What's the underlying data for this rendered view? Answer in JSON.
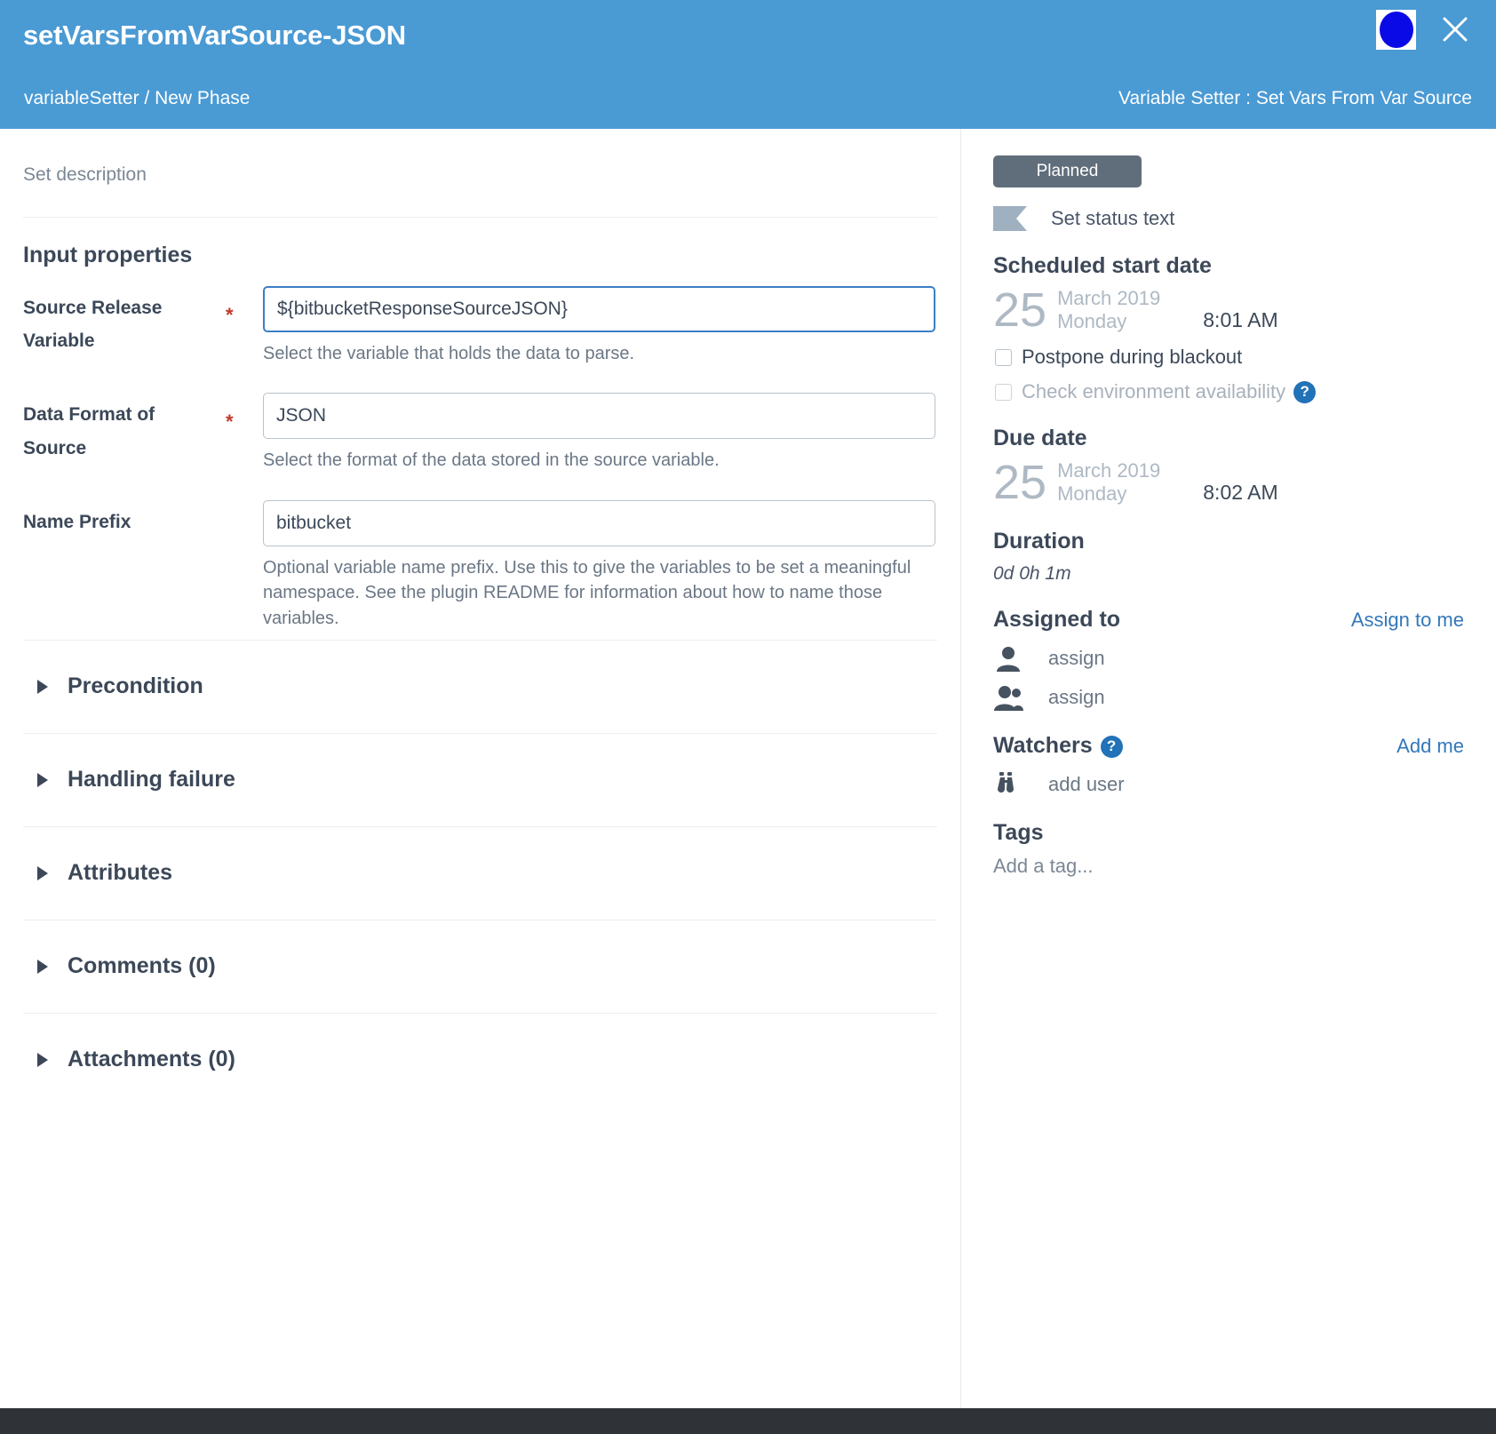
{
  "header": {
    "title": "setVarsFromVarSource-JSON",
    "breadcrumb": "variableSetter / New Phase",
    "task_type": "Variable Setter : Set Vars From Var Source",
    "avatar_icon": "user-avatar-circle-icon",
    "close_icon": "close-icon",
    "background_color": "#4a9ad4",
    "avatar_color": "#0a0ae6"
  },
  "main": {
    "set_description_placeholder": "Set description",
    "input_properties_title": "Input properties",
    "fields": [
      {
        "label": "Source Release Variable",
        "required": "*",
        "value": "${bitbucketResponseSourceJSON}",
        "help": "Select the variable that holds the data to parse.",
        "focused": true
      },
      {
        "label": "Data Format of Source",
        "required": "*",
        "value": "JSON",
        "help": "Select the format of the data stored in the source variable.",
        "focused": false
      },
      {
        "label": "Name Prefix",
        "required": "",
        "value": "bitbucket",
        "help": "Optional variable name prefix. Use this to give the variables to be set a meaningful namespace. See the plugin README for information about how to name those variables.",
        "focused": false
      }
    ],
    "accordions": [
      {
        "label": "Precondition",
        "icon": "chevron-right-icon"
      },
      {
        "label": "Handling failure",
        "icon": "chevron-right-icon"
      },
      {
        "label": "Attributes",
        "icon": "chevron-right-icon"
      },
      {
        "label": "Comments (0)",
        "icon": "chevron-right-icon"
      },
      {
        "label": "Attachments (0)",
        "icon": "chevron-right-icon"
      }
    ]
  },
  "sidebar": {
    "status_badge": "Planned",
    "status_badge_color": "#606d7b",
    "status_text_label": "Set status text",
    "status_flag_icon": "flag-icon",
    "scheduled_start": {
      "heading": "Scheduled start date",
      "day": "25",
      "month_year": "March 2019",
      "weekday": "Monday",
      "time": "8:01 AM"
    },
    "postpone": {
      "label": "Postpone during blackout",
      "checked": false
    },
    "check_environment": {
      "label": "Check environment availability",
      "checked": false,
      "disabled": true,
      "help_icon": "question-mark-icon"
    },
    "due_date": {
      "heading": "Due date",
      "day": "25",
      "month_year": "March 2019",
      "weekday": "Monday",
      "time": "8:02 AM"
    },
    "duration": {
      "heading": "Duration",
      "value": "0d 0h 1m"
    },
    "assigned_to": {
      "heading": "Assigned to",
      "action": "Assign to me",
      "rows": [
        {
          "icon": "person-icon",
          "label": "assign"
        },
        {
          "icon": "people-icon",
          "label": "assign"
        }
      ]
    },
    "watchers": {
      "heading": "Watchers",
      "help_icon": "question-mark-icon",
      "action": "Add me",
      "rows": [
        {
          "icon": "binoculars-icon",
          "label": "add user"
        }
      ]
    },
    "tags": {
      "heading": "Tags",
      "placeholder": "Add a tag..."
    },
    "link_color": "#3377bb"
  }
}
